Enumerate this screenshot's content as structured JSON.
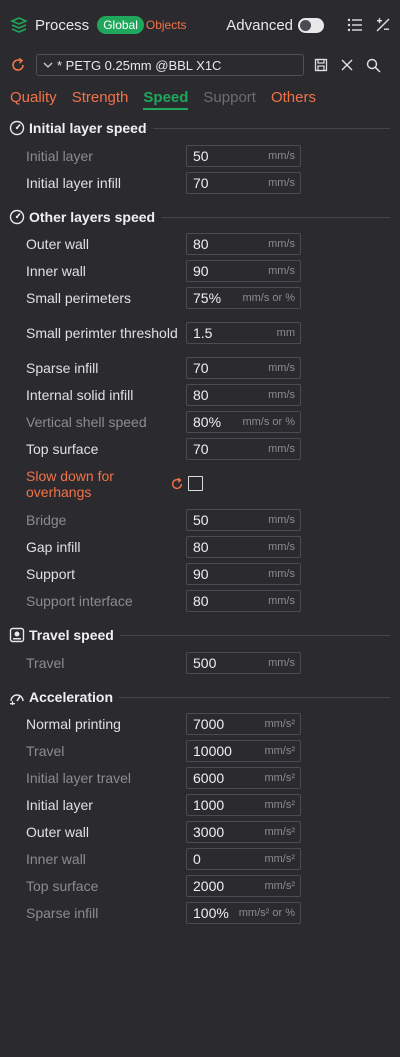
{
  "header": {
    "title": "Process",
    "segment_global": "Global",
    "segment_objects": "Objects",
    "advanced_label": "Advanced",
    "advanced_on": true
  },
  "preset": {
    "name": "* PETG 0.25mm @BBL X1C"
  },
  "tabs": [
    {
      "label": "Quality",
      "state": "normal"
    },
    {
      "label": "Strength",
      "state": "normal"
    },
    {
      "label": "Speed",
      "state": "active"
    },
    {
      "label": "Support",
      "state": "dim"
    },
    {
      "label": "Others",
      "state": "normal"
    }
  ],
  "sections": {
    "initial_layer_speed": {
      "title": "Initial layer speed",
      "rows": [
        {
          "label": "Initial layer",
          "value": "50",
          "unit": "mm/s"
        },
        {
          "label": "Initial layer infill",
          "value": "70",
          "unit": "mm/s"
        }
      ]
    },
    "other_layers_speed": {
      "title": "Other layers speed",
      "rows": [
        {
          "label": "Outer wall",
          "value": "80",
          "unit": "mm/s"
        },
        {
          "label": "Inner wall",
          "value": "90",
          "unit": "mm/s"
        },
        {
          "label": "Small perimeters",
          "value": "75%",
          "unit": "mm/s or %"
        },
        {
          "label": "Small perimter threshold",
          "value": "1.5",
          "unit": "mm"
        },
        {
          "label": "Sparse infill",
          "value": "70",
          "unit": "mm/s"
        },
        {
          "label": "Internal solid infill",
          "value": "80",
          "unit": "mm/s"
        },
        {
          "label": "Vertical shell speed",
          "value": "80%",
          "unit": "mm/s or %"
        },
        {
          "label": "Top surface",
          "value": "70",
          "unit": "mm/s"
        },
        {
          "label": "Slow down for overhangs",
          "checked": false
        },
        {
          "label": "Bridge",
          "value": "50",
          "unit": "mm/s"
        },
        {
          "label": "Gap infill",
          "value": "80",
          "unit": "mm/s"
        },
        {
          "label": "Support",
          "value": "90",
          "unit": "mm/s"
        },
        {
          "label": "Support interface",
          "value": "80",
          "unit": "mm/s"
        }
      ]
    },
    "travel_speed": {
      "title": "Travel speed",
      "rows": [
        {
          "label": "Travel",
          "value": "500",
          "unit": "mm/s"
        }
      ]
    },
    "acceleration": {
      "title": "Acceleration",
      "rows": [
        {
          "label": "Normal printing",
          "value": "7000",
          "unit": "mm/s²"
        },
        {
          "label": "Travel",
          "value": "10000",
          "unit": "mm/s²"
        },
        {
          "label": "Initial layer travel",
          "value": "6000",
          "unit": "mm/s²"
        },
        {
          "label": "Initial layer",
          "value": "1000",
          "unit": "mm/s²"
        },
        {
          "label": "Outer wall",
          "value": "3000",
          "unit": "mm/s²"
        },
        {
          "label": "Inner wall",
          "value": "0",
          "unit": "mm/s²"
        },
        {
          "label": "Top surface",
          "value": "2000",
          "unit": "mm/s²"
        },
        {
          "label": "Sparse infill",
          "value": "100%",
          "unit": "mm/s² or %"
        }
      ]
    }
  },
  "colors": {
    "accent_green": "#1fa75b",
    "accent_orange": "#f27248",
    "background": "#2b2b2f"
  }
}
